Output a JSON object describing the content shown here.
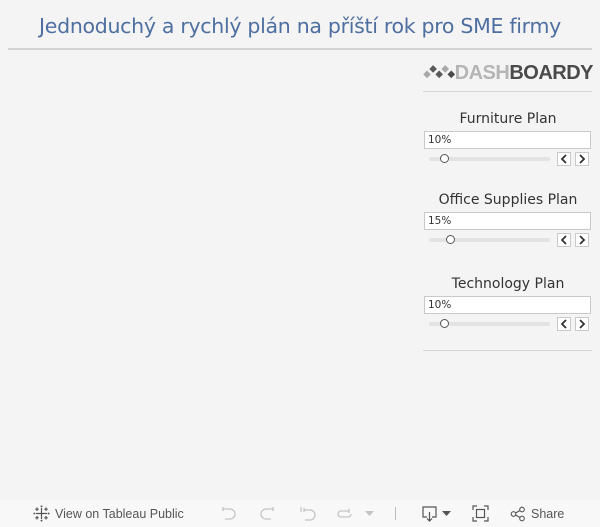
{
  "header": {
    "title": "Jednoduchý a rychlý plán na příští rok pro SME firmy"
  },
  "logo": {
    "brand_light": "DASH",
    "brand_dark": "BOARDY",
    "icon": "diamond-cluster-logo-icon"
  },
  "parameters": [
    {
      "title": "Furniture Plan",
      "value_text": "10%",
      "slider_fraction": 0.1,
      "prev_icon": "chevron-left-icon",
      "next_icon": "chevron-right-icon"
    },
    {
      "title": "Office Supplies Plan",
      "value_text": "15%",
      "slider_fraction": 0.15,
      "prev_icon": "chevron-left-icon",
      "next_icon": "chevron-right-icon"
    },
    {
      "title": "Technology Plan",
      "value_text": "10%",
      "slider_fraction": 0.1,
      "prev_icon": "chevron-left-icon",
      "next_icon": "chevron-right-icon"
    }
  ],
  "toolbar": {
    "view_on_public_label": "View on Tableau Public",
    "share_label": "Share",
    "icons": [
      "tableau-logo-icon",
      "undo-icon",
      "redo-icon",
      "revert-icon",
      "refresh-icon",
      "dropdown-caret-icon",
      "download-icon",
      "fullscreen-icon",
      "share-icon"
    ]
  },
  "colors": {
    "title": "#4e6fa0",
    "background": "#f4f4f4",
    "toolbar_bg": "#f8f8f8"
  }
}
